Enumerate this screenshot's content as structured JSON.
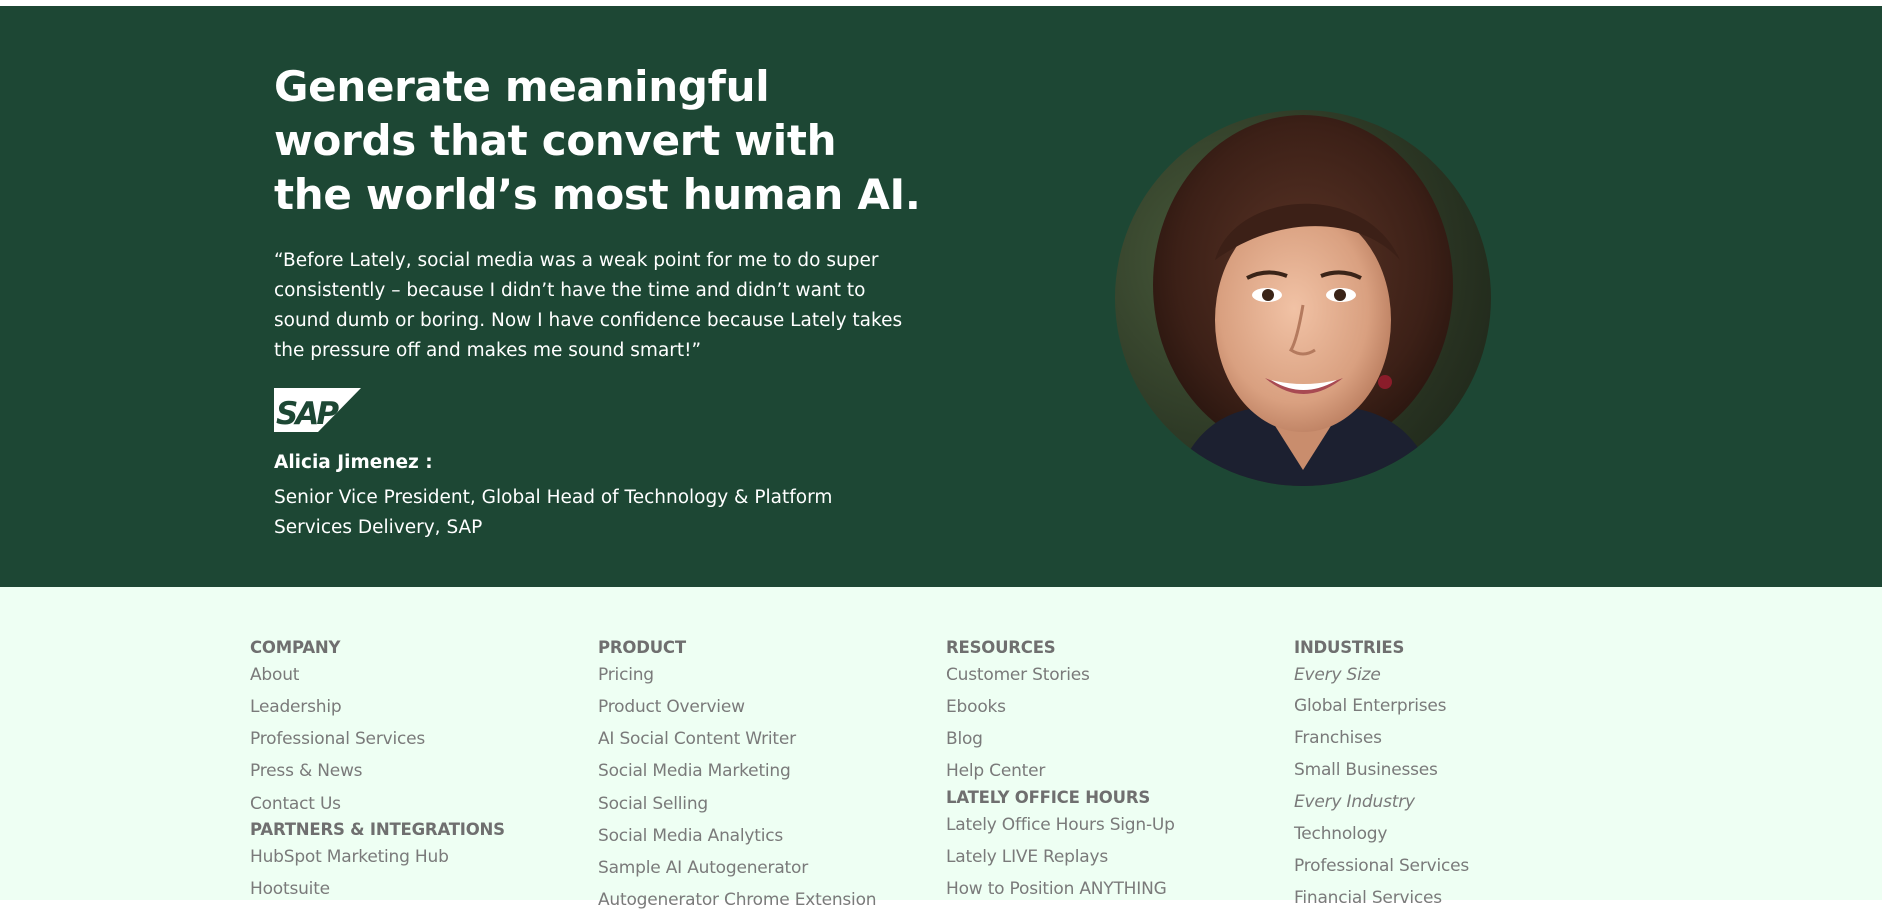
{
  "hero": {
    "headline": "Generate meaningful words that convert with the world’s most human AI.",
    "quote": "“Before Lately, social media was a weak point for me to do super consistently – because I didn’t have the time and didn’t want to sound dumb or boring. Now I have confidence because Lately takes the pressure off and makes me sound smart!”",
    "logo_text": "SAP",
    "person_name": "Alicia Jimenez :",
    "person_title": "Senior Vice President, Global Head of Technology & Platform Services Delivery, SAP"
  },
  "footer": {
    "company": {
      "heading": "COMPANY",
      "links": [
        "About",
        "Leadership",
        "Professional Services",
        "Press & News",
        "Contact Us"
      ]
    },
    "partners": {
      "heading": "PARTNERS & INTEGRATIONS",
      "links": [
        "HubSpot Marketing Hub",
        "Hootsuite"
      ]
    },
    "product": {
      "heading": "PRODUCT",
      "links": [
        "Pricing",
        "Product Overview",
        "AI Social Content Writer",
        "Social Media Marketing",
        "Social Selling",
        "Social Media Analytics",
        "Sample AI Autogenerator",
        "Autogenerator Chrome Extension"
      ]
    },
    "resources": {
      "heading": "RESOURCES",
      "links": [
        "Customer Stories",
        "Ebooks",
        "Blog",
        "Help Center"
      ]
    },
    "office_hours": {
      "heading": "LATELY OFFICE HOURS",
      "links": [
        "Lately Office Hours Sign-Up",
        "Lately LIVE Replays",
        "How to Position ANYTHING"
      ]
    },
    "industries": {
      "heading": "INDUSTRIES",
      "links": [
        "Every Size",
        "Global Enterprises",
        "Franchises",
        "Small Businesses",
        "Every Industry",
        "Technology",
        "Professional Services",
        "Financial Services"
      ]
    }
  }
}
